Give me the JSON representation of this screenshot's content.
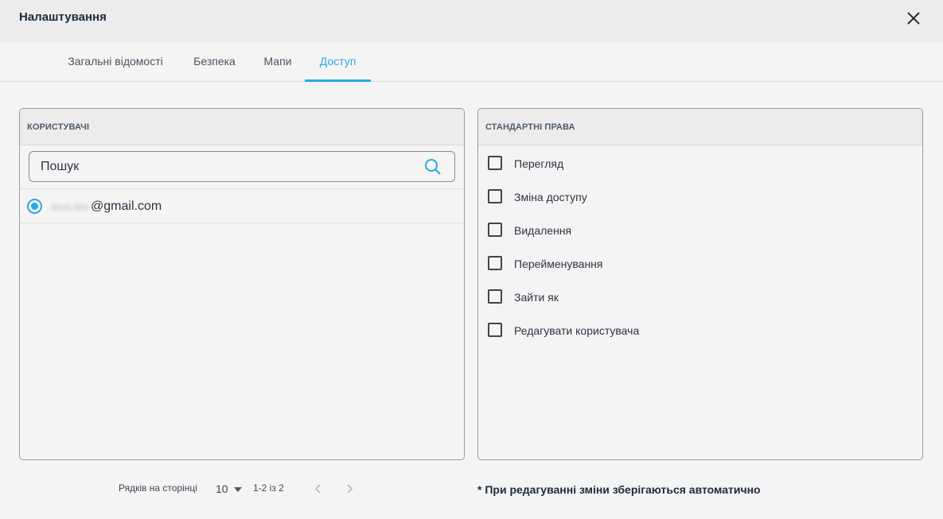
{
  "dialog": {
    "title": "Налаштування"
  },
  "tabs": [
    {
      "label": "Загальні відомості"
    },
    {
      "label": "Безпека"
    },
    {
      "label": "Мапи"
    },
    {
      "label": "Доступ"
    }
  ],
  "users_panel": {
    "header": "КОРИСТУВАЧІ",
    "search_placeholder": "Пошук",
    "users": [
      {
        "email_hidden": "asus.dev",
        "email_domain": "@gmail.com",
        "selected": true
      }
    ]
  },
  "rights_panel": {
    "header": "СТАНДАРТНІ ПРАВА",
    "permissions": [
      {
        "label": "Перегляд",
        "checked": false
      },
      {
        "label": "Зміна доступу",
        "checked": false
      },
      {
        "label": "Видалення",
        "checked": false
      },
      {
        "label": "Перейменування",
        "checked": false
      },
      {
        "label": "Зайти як",
        "checked": false
      },
      {
        "label": "Редагувати користувача",
        "checked": false
      }
    ]
  },
  "pagination": {
    "rows_label": "Рядків на сторінці",
    "rows_value": "10",
    "range": "1-2 із 2"
  },
  "footer_note": "* При редагуванні зміни зберігаються автоматично",
  "colors": {
    "accent": "#29a9e1"
  },
  "icons": [
    "close-icon",
    "search-icon",
    "chevron-down-icon",
    "chevron-left-icon",
    "chevron-right-icon"
  ]
}
